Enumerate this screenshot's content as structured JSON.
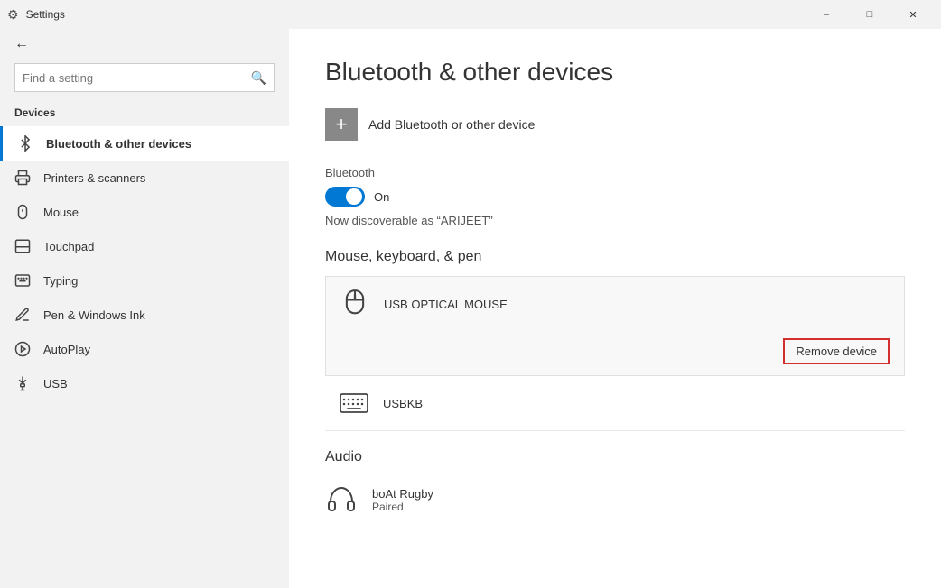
{
  "titleBar": {
    "title": "Settings",
    "controls": [
      "minimize",
      "maximize",
      "close"
    ]
  },
  "sidebar": {
    "backLabel": "Settings",
    "searchPlaceholder": "Find a setting",
    "sectionLabel": "Devices",
    "items": [
      {
        "id": "bluetooth",
        "label": "Bluetooth & other devices",
        "icon": "bluetooth",
        "active": true
      },
      {
        "id": "printers",
        "label": "Printers & scanners",
        "icon": "printer",
        "active": false
      },
      {
        "id": "mouse",
        "label": "Mouse",
        "icon": "mouse",
        "active": false
      },
      {
        "id": "touchpad",
        "label": "Touchpad",
        "icon": "touchpad",
        "active": false
      },
      {
        "id": "typing",
        "label": "Typing",
        "icon": "typing",
        "active": false
      },
      {
        "id": "pen",
        "label": "Pen & Windows Ink",
        "icon": "pen",
        "active": false
      },
      {
        "id": "autoplay",
        "label": "AutoPlay",
        "icon": "autoplay",
        "active": false
      },
      {
        "id": "usb",
        "label": "USB",
        "icon": "usb",
        "active": false
      }
    ]
  },
  "content": {
    "title": "Bluetooth & other devices",
    "addDeviceLabel": "Add Bluetooth or other device",
    "bluetoothSection": {
      "label": "Bluetooth",
      "toggleState": "On",
      "discoverableText": "Now discoverable as “ARIJEET”"
    },
    "mouseKeyboardSection": {
      "title": "Mouse, keyboard, & pen",
      "devices": [
        {
          "name": "USB OPTICAL MOUSE",
          "type": "mouse",
          "hasRemove": true,
          "removeLabel": "Remove device"
        },
        {
          "name": "USBKB",
          "type": "keyboard",
          "hasRemove": false
        }
      ]
    },
    "audioSection": {
      "title": "Audio",
      "devices": [
        {
          "name": "boAt Rugby",
          "status": "Paired",
          "type": "headphones"
        }
      ]
    }
  }
}
